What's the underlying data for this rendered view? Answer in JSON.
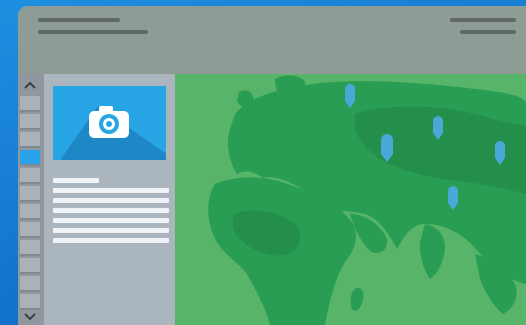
{
  "colors": {
    "background": "#1a80d8",
    "titlebar": "#8f9c96",
    "sidebar": "#aab5bd",
    "accent": "#27a5e5",
    "map_land": "#2a9d55",
    "map_water": "#58b468",
    "pin": "#4aa8d8"
  },
  "titlebar": {
    "left_icon": "window-title-lines",
    "right_icon": "hamburger-menu-icon"
  },
  "scrollbar": {
    "up_icon": "chevron-up-icon",
    "down_icon": "chevron-down-icon",
    "up_glyph": "^",
    "down_glyph": "v"
  },
  "sidebar": {
    "thumbnail_icon": "camera-icon",
    "text_lines": 6
  },
  "map": {
    "pins": [
      "map-pin",
      "map-pin",
      "map-pin",
      "map-pin",
      "map-pin"
    ]
  }
}
